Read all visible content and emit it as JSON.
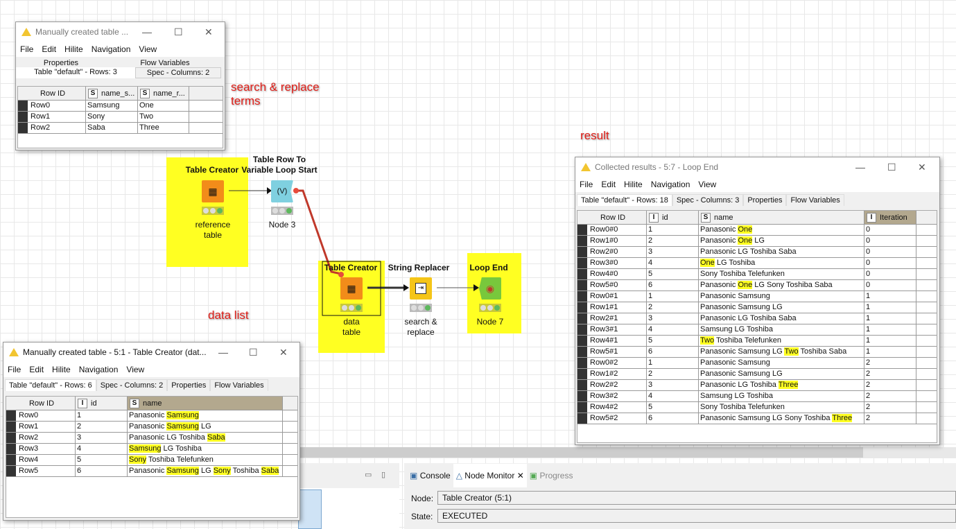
{
  "annotations": {
    "search_replace": "search & replace\nterms",
    "result": "result",
    "data_list": "data list"
  },
  "nodes": [
    {
      "title": "Table Creator",
      "sub": "reference\ntable",
      "icon": "table-creator-icon"
    },
    {
      "title": "Table Row To\nVariable Loop Start",
      "sub": "Node 3",
      "icon": "variable-loop-icon"
    },
    {
      "title": "Table Creator",
      "sub": "data\ntable",
      "icon": "table-creator-icon"
    },
    {
      "title": "String Replacer",
      "sub": "search &\nreplace",
      "icon": "string-replacer-icon"
    },
    {
      "title": "Loop End",
      "sub": "Node 7",
      "icon": "loop-end-icon"
    }
  ],
  "colors": {
    "highlight": "#ffff22",
    "node_orange": "#f28c1a",
    "node_yellow": "#f5c518",
    "node_blue": "#7fd0e0",
    "node_green": "#78c83c",
    "connection_red": "#c0392b"
  },
  "menu": [
    "File",
    "Edit",
    "Hilite",
    "Navigation",
    "View"
  ],
  "win_ref": {
    "title": "Manually created table ...",
    "tabs_top": [
      "Properties",
      "Flow Variables"
    ],
    "tabs": [
      "Table \"default\" - Rows: 3",
      "Spec - Columns: 2"
    ],
    "columns": [
      {
        "label": "Row ID"
      },
      {
        "label": "name_s...",
        "type": "S"
      },
      {
        "label": "name_r...",
        "type": "S"
      }
    ],
    "rows": [
      [
        "Row0",
        "Samsung",
        "One"
      ],
      [
        "Row1",
        "Sony",
        "Two"
      ],
      [
        "Row2",
        "Saba",
        "Three"
      ]
    ]
  },
  "win_data": {
    "title": "Manually created table - 5:1 - Table Creator (dat...",
    "tabs": [
      "Table \"default\" - Rows: 6",
      "Spec - Columns: 2",
      "Properties",
      "Flow Variables"
    ],
    "columns": [
      {
        "label": "Row ID"
      },
      {
        "label": "id",
        "type": "I"
      },
      {
        "label": "name",
        "type": "S"
      }
    ],
    "rows": [
      [
        "Row0",
        "1",
        [
          [
            "Panasonic ",
            0
          ],
          [
            "Samsung",
            1
          ]
        ]
      ],
      [
        "Row1",
        "2",
        [
          [
            "Panasonic ",
            0
          ],
          [
            "Samsung",
            1
          ],
          [
            " LG",
            0
          ]
        ]
      ],
      [
        "Row2",
        "3",
        [
          [
            "Panasonic LG Toshiba ",
            0
          ],
          [
            "Saba",
            1
          ]
        ]
      ],
      [
        "Row3",
        "4",
        [
          [
            "Samsung",
            1
          ],
          [
            " LG Toshiba",
            0
          ]
        ]
      ],
      [
        "Row4",
        "5",
        [
          [
            "Sony",
            1
          ],
          [
            " Toshiba Telefunken",
            0
          ]
        ]
      ],
      [
        "Row5",
        "6",
        [
          [
            "Panasonic ",
            0
          ],
          [
            "Samsung",
            1
          ],
          [
            " LG ",
            0
          ],
          [
            "Sony",
            1
          ],
          [
            " Toshiba ",
            0
          ],
          [
            "Saba",
            1
          ]
        ]
      ]
    ]
  },
  "win_result": {
    "title": "Collected results - 5:7 - Loop End",
    "tabs": [
      "Table \"default\" - Rows: 18",
      "Spec - Columns: 3",
      "Properties",
      "Flow Variables"
    ],
    "columns": [
      {
        "label": "Row ID"
      },
      {
        "label": "id",
        "type": "I"
      },
      {
        "label": "name",
        "type": "S"
      },
      {
        "label": "Iteration",
        "type": "I"
      }
    ],
    "rows": [
      [
        "Row0#0",
        "1",
        [
          [
            "Panasonic ",
            0
          ],
          [
            "One",
            1
          ]
        ],
        "0"
      ],
      [
        "Row1#0",
        "2",
        [
          [
            "Panasonic ",
            0
          ],
          [
            "One",
            1
          ],
          [
            " LG",
            0
          ]
        ],
        "0"
      ],
      [
        "Row2#0",
        "3",
        [
          [
            "Panasonic LG Toshiba Saba",
            0
          ]
        ],
        "0"
      ],
      [
        "Row3#0",
        "4",
        [
          [
            "One",
            1
          ],
          [
            " LG Toshiba",
            0
          ]
        ],
        "0"
      ],
      [
        "Row4#0",
        "5",
        [
          [
            "Sony Toshiba Telefunken",
            0
          ]
        ],
        "0"
      ],
      [
        "Row5#0",
        "6",
        [
          [
            "Panasonic ",
            0
          ],
          [
            "One",
            1
          ],
          [
            " LG Sony Toshiba Saba",
            0
          ]
        ],
        "0"
      ],
      [
        "Row0#1",
        "1",
        [
          [
            "Panasonic Samsung",
            0
          ]
        ],
        "1"
      ],
      [
        "Row1#1",
        "2",
        [
          [
            "Panasonic Samsung LG",
            0
          ]
        ],
        "1"
      ],
      [
        "Row2#1",
        "3",
        [
          [
            "Panasonic LG Toshiba Saba",
            0
          ]
        ],
        "1"
      ],
      [
        "Row3#1",
        "4",
        [
          [
            "Samsung LG Toshiba",
            0
          ]
        ],
        "1"
      ],
      [
        "Row4#1",
        "5",
        [
          [
            "Two",
            1
          ],
          [
            " Toshiba Telefunken",
            0
          ]
        ],
        "1"
      ],
      [
        "Row5#1",
        "6",
        [
          [
            "Panasonic Samsung LG ",
            0
          ],
          [
            "Two",
            1
          ],
          [
            " Toshiba Saba",
            0
          ]
        ],
        "1"
      ],
      [
        "Row0#2",
        "1",
        [
          [
            "Panasonic Samsung",
            0
          ]
        ],
        "2"
      ],
      [
        "Row1#2",
        "2",
        [
          [
            "Panasonic Samsung LG",
            0
          ]
        ],
        "2"
      ],
      [
        "Row2#2",
        "3",
        [
          [
            "Panasonic LG Toshiba ",
            0
          ],
          [
            "Three",
            1
          ]
        ],
        "2"
      ],
      [
        "Row3#2",
        "4",
        [
          [
            "Samsung LG Toshiba",
            0
          ]
        ],
        "2"
      ],
      [
        "Row4#2",
        "5",
        [
          [
            "Sony Toshiba Telefunken",
            0
          ]
        ],
        "2"
      ],
      [
        "Row5#2",
        "6",
        [
          [
            "Panasonic Samsung LG Sony Toshiba ",
            0
          ],
          [
            "Three",
            1
          ]
        ],
        "2"
      ]
    ]
  },
  "bottom": {
    "tabs": [
      "Console",
      "Node Monitor",
      "Progress"
    ],
    "node_label": "Node:",
    "node_value": "Table Creator  (5:1)",
    "state_label": "State:",
    "state_value": "EXECUTED"
  }
}
